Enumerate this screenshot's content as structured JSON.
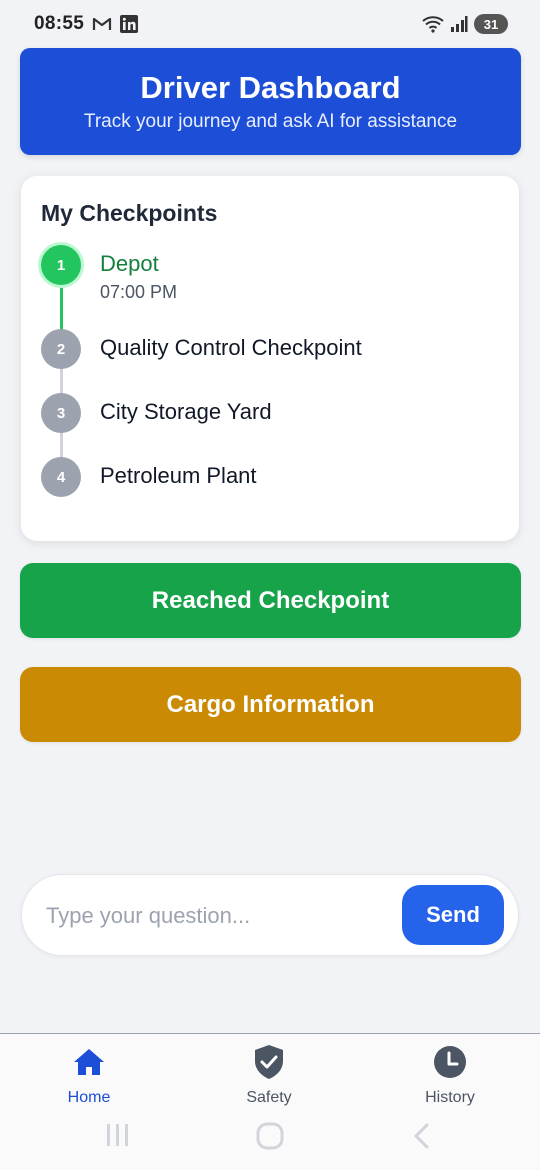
{
  "status_bar": {
    "time": "08:55",
    "battery": "31",
    "icons": [
      "gmail-icon",
      "linkedin-icon",
      "wifi-icon",
      "signal-icon",
      "battery-icon"
    ]
  },
  "header": {
    "title": "Driver Dashboard",
    "subtitle": "Track your journey and ask AI for assistance",
    "color": "#1d4ed8"
  },
  "checkpoints": {
    "title": "My Checkpoints",
    "items": [
      {
        "number": "1",
        "name": "Depot",
        "time": "07:00 PM",
        "status": "reached",
        "color": "#22c55e"
      },
      {
        "number": "2",
        "name": "Quality Control Checkpoint",
        "status": "pending",
        "color": "#9ca3af"
      },
      {
        "number": "3",
        "name": "City Storage Yard",
        "status": "pending",
        "color": "#9ca3af"
      },
      {
        "number": "4",
        "name": "Petroleum Plant",
        "status": "pending",
        "color": "#9ca3af"
      }
    ]
  },
  "actions": {
    "reached_label": "Reached Checkpoint",
    "cargo_label": "Cargo Information",
    "reached_color": "#16a34a",
    "cargo_color": "#ca8a04"
  },
  "chat": {
    "placeholder": "Type your question...",
    "value": "",
    "send_label": "Send"
  },
  "bottom_nav": {
    "items": [
      {
        "label": "Home",
        "icon": "home-icon",
        "active": true
      },
      {
        "label": "Safety",
        "icon": "shield-check-icon",
        "active": false
      },
      {
        "label": "History",
        "icon": "clock-icon",
        "active": false
      }
    ],
    "active_color": "#1d4ed8"
  },
  "system_nav": {
    "icons": [
      "recent-apps-icon",
      "home-button-icon",
      "back-icon"
    ]
  }
}
